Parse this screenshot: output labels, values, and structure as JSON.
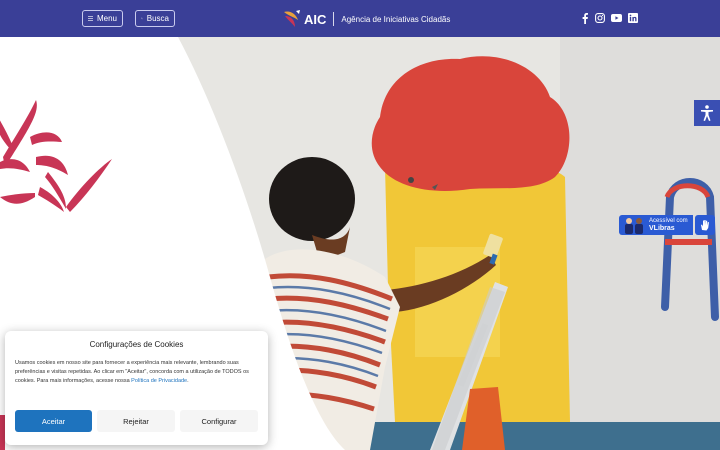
{
  "header": {
    "menu_label": "Menu",
    "search_label": "Busca",
    "logo_text": "AIC",
    "tagline": "Agência de Iniciativas Cidadãs",
    "social": [
      "facebook-icon",
      "instagram-icon",
      "youtube-icon",
      "linkedin-icon"
    ]
  },
  "vlibras": {
    "line1": "Acessível com",
    "line2": "VLibras"
  },
  "cookie": {
    "title": "Configurações de Cookies",
    "text_before": "Usamos cookies em nosso site para fornecer a experiência mais relevante, lembrando suas preferências e visitas repetidas. Ao clicar em \"Aceitar\", concorda com a utilização de TODOS os cookies. Para mais informações, acesse nossa ",
    "link": "Política de Privacidade",
    "text_after": ".",
    "accept": "Aceitar",
    "reject": "Rejeitar",
    "configure": "Configurar"
  },
  "colors": {
    "header_bg": "#3a3f97",
    "brand_red": "#c83556",
    "accept_btn": "#1e73be"
  }
}
